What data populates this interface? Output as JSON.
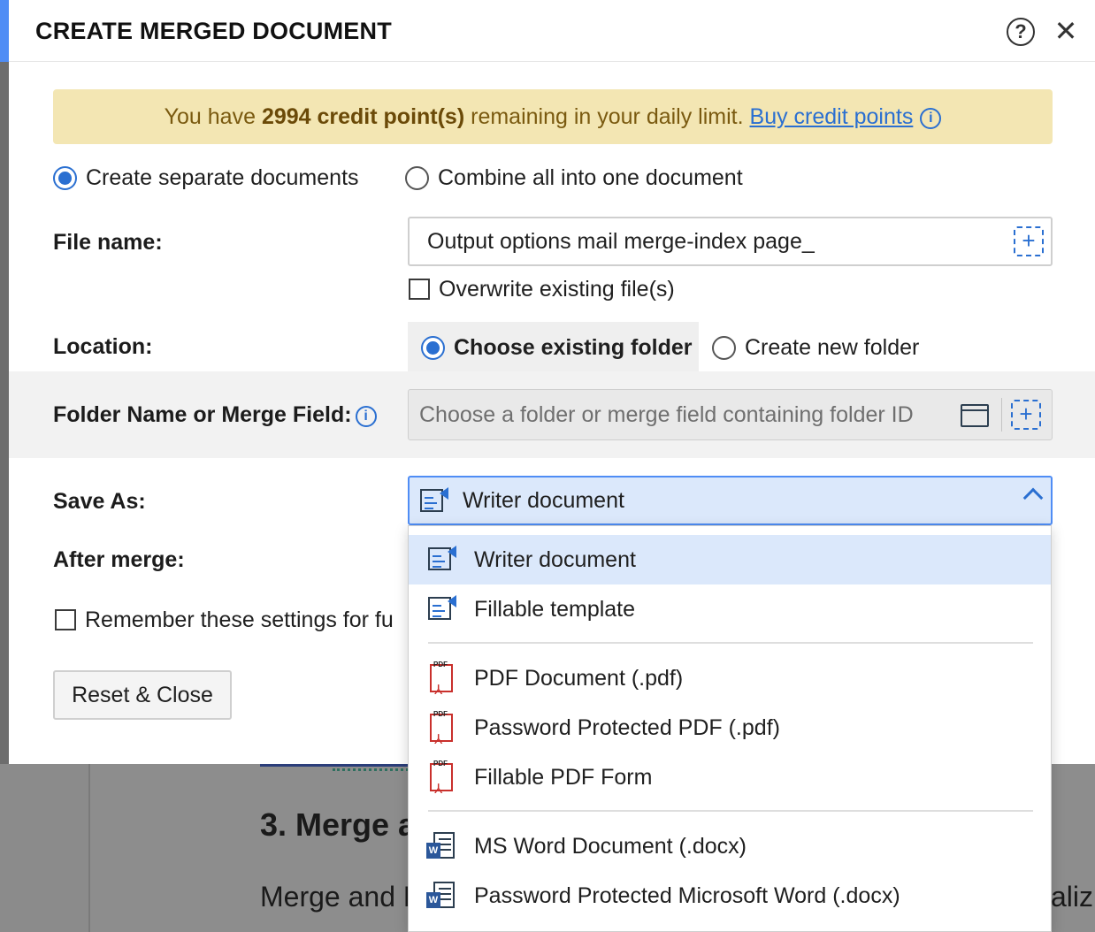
{
  "background_doc": {
    "heading": "3. Merge a",
    "paragraph_left": "Merge and E",
    "paragraph_right": "aliz"
  },
  "dialog": {
    "title": "CREATE MERGED DOCUMENT",
    "help_glyph": "?",
    "close_glyph": "✕"
  },
  "banner": {
    "prefix": "You have ",
    "credits": "2994 credit point(s)",
    "suffix": " remaining in your daily limit. ",
    "link": "Buy credit points",
    "info_glyph": "i"
  },
  "mode": {
    "separate": "Create separate documents",
    "combine": "Combine all into one document",
    "selected": "separate"
  },
  "file_name": {
    "label": "File name:",
    "value": "Output options mail merge-index page_",
    "overwrite": "Overwrite existing file(s)"
  },
  "location": {
    "label": "Location:",
    "existing": "Choose existing folder",
    "new": "Create new folder",
    "selected": "existing"
  },
  "folder": {
    "label": "Folder Name or Merge Field:",
    "placeholder": "Choose a folder or merge field containing folder ID"
  },
  "save_as": {
    "label": "Save As:",
    "value": "Writer document"
  },
  "after_merge": {
    "label": "After merge:"
  },
  "remember": "Remember these settings for fu",
  "reset_button": "Reset & Close",
  "plus_glyph": "+",
  "menu": {
    "items": [
      {
        "label": "Writer document",
        "icon": "writer-doc-icon",
        "selected": true
      },
      {
        "label": "Fillable template",
        "icon": "writer-doc-icon"
      },
      {
        "label": "PDF Document (.pdf)",
        "icon": "pdf-icon"
      },
      {
        "label": "Password Protected PDF (.pdf)",
        "icon": "pdf-icon"
      },
      {
        "label": "Fillable PDF Form",
        "icon": "pdf-icon"
      },
      {
        "label": "MS Word Document (.docx)",
        "icon": "word-icon"
      },
      {
        "label": "Password Protected Microsoft Word (.docx)",
        "icon": "word-icon"
      }
    ],
    "pdf_badge": "PDF",
    "word_badge": "W"
  },
  "colors": {
    "accent": "#2a6fd1",
    "selection": "#dbe8fb",
    "banner_bg": "#f3e6b3"
  }
}
